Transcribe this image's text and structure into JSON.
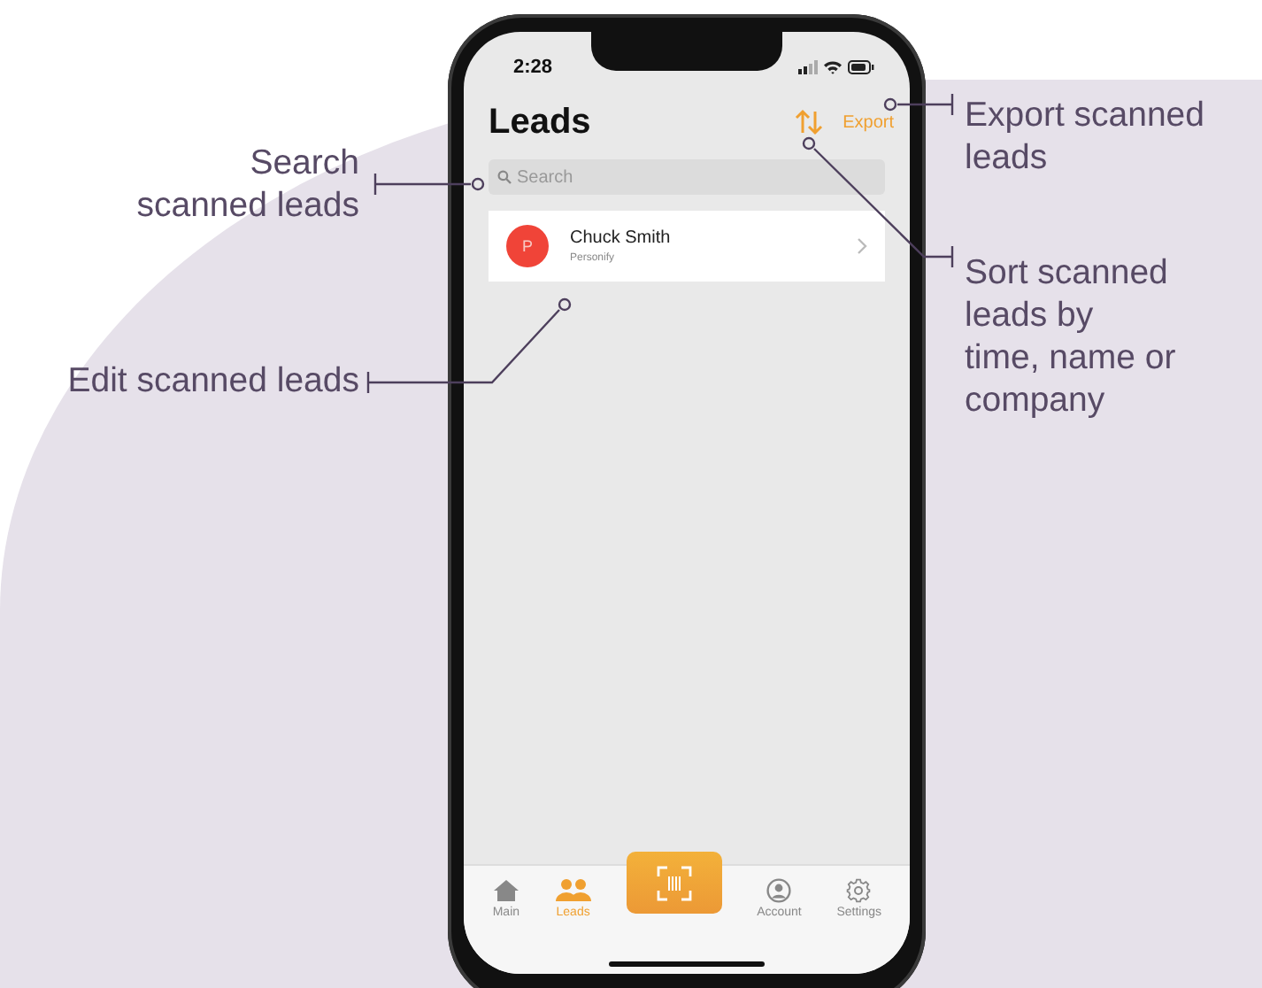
{
  "annotations": [
    {
      "kind": "search",
      "lines": [
        "Search",
        "scanned leads"
      ]
    },
    {
      "kind": "edit",
      "lines": [
        "Edit scanned leads"
      ]
    },
    {
      "kind": "export",
      "lines": [
        "Export scanned",
        "leads"
      ]
    },
    {
      "kind": "sort",
      "lines": [
        "Sort scanned",
        "leads by",
        "time, name or",
        "company"
      ]
    }
  ],
  "screen": {
    "status_time": "2:28",
    "title": "Leads",
    "export_label": "Export",
    "search": {
      "placeholder": "Search"
    },
    "leads": [
      {
        "initial": "P",
        "name": "Chuck Smith",
        "company": "Personify"
      }
    ],
    "tab_bar": [
      {
        "kind": "home",
        "label": "Main",
        "selected": false
      },
      {
        "kind": "people",
        "label": "Leads",
        "selected": true
      },
      {
        "kind": "scan",
        "selected": false
      },
      {
        "kind": "account",
        "label": "Account",
        "selected": false
      },
      {
        "kind": "settings",
        "label": "Settings",
        "selected": false
      }
    ]
  }
}
